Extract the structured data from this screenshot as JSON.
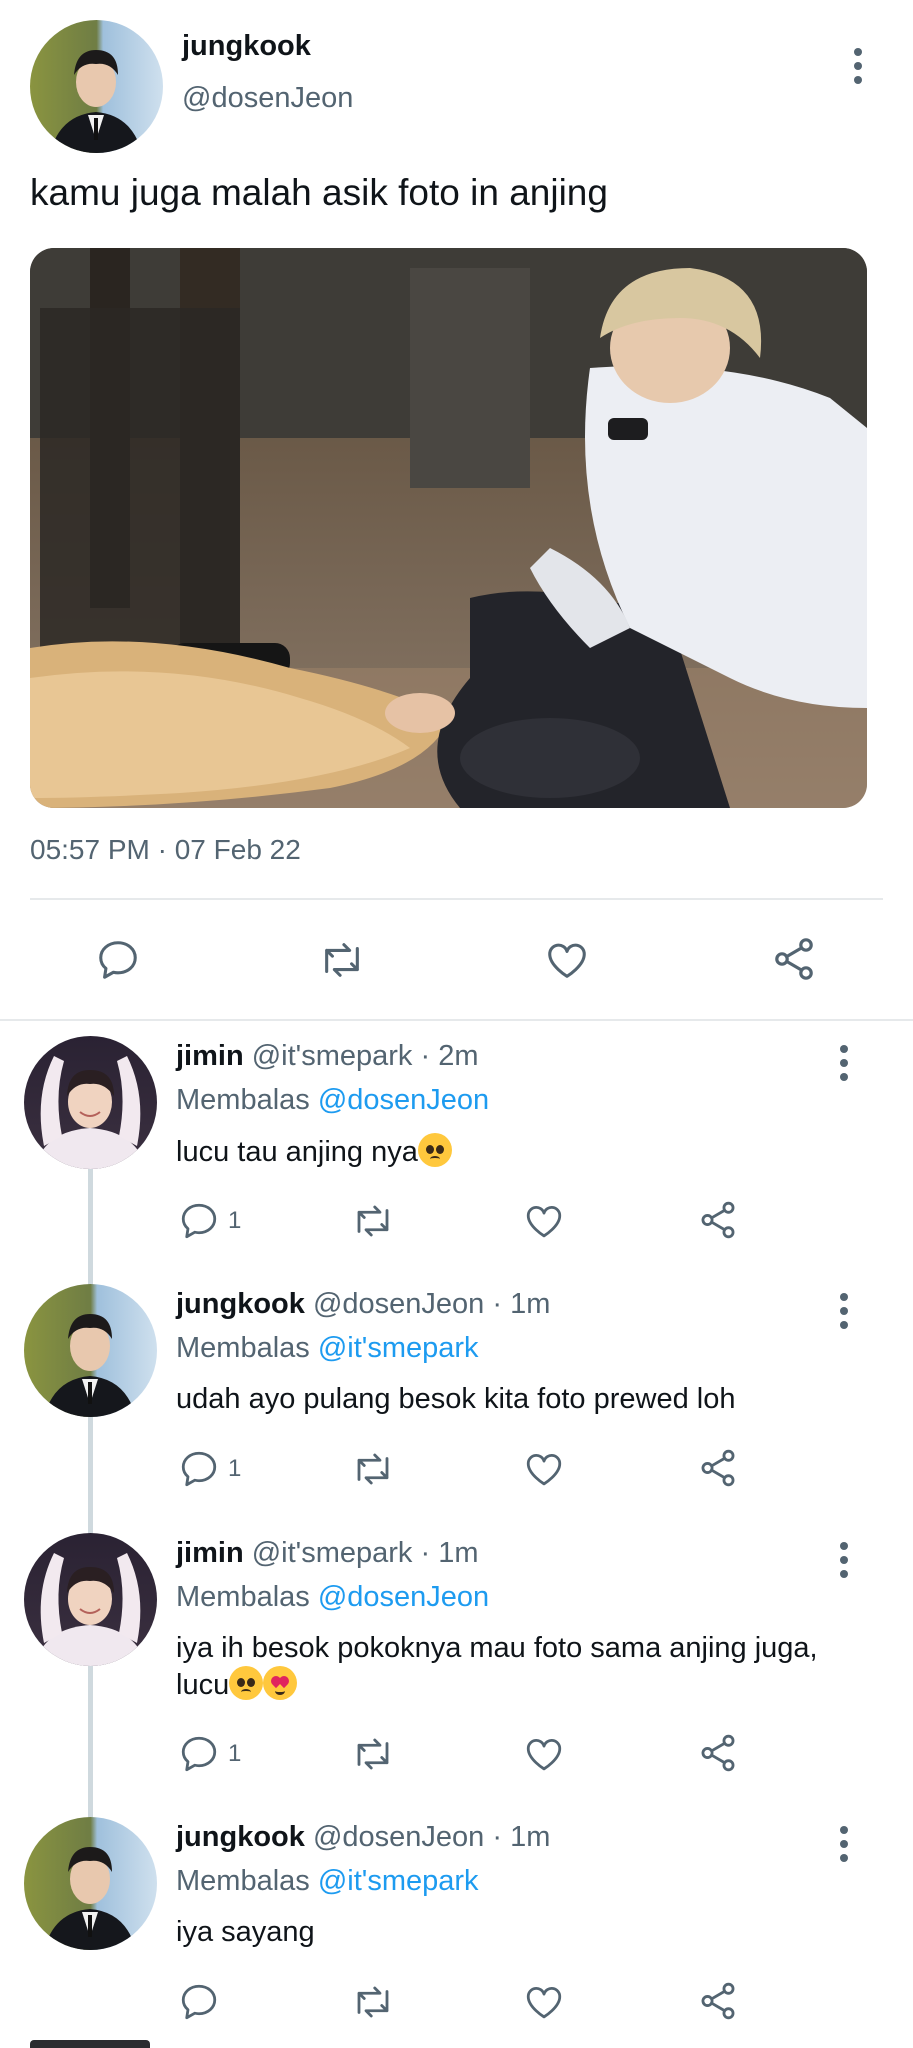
{
  "tweet": {
    "author_name": "jungkook",
    "author_handle": "@dosenJeon",
    "text": "kamu juga malah asik foto in anjing",
    "timestamp": "05:57 PM · 07 Feb 22",
    "media_alt": "person in white shirt sitting on floor holding phone, petting a dog"
  },
  "icons": {
    "reply": "reply-icon",
    "retweet": "retweet-icon",
    "like": "heart-icon",
    "share": "share-icon",
    "more": "more-options-icon"
  },
  "colors": {
    "link": "#1d9bf0",
    "secondary": "#536471",
    "text": "#0f1419",
    "divider": "#e6e9eb"
  },
  "replies": [
    {
      "name": "jimin",
      "handle": "@it'smepark",
      "time": "· 2m",
      "replying_label": "Membalas",
      "replying_to": "@dosenJeon",
      "text": "lucu tau anjing nya",
      "text_line2": "",
      "reply_count": "1"
    },
    {
      "name": "jungkook",
      "handle": "@dosenJeon",
      "time": "· 1m",
      "replying_label": "Membalas",
      "replying_to": "@it'smepark",
      "text": "udah ayo pulang besok kita foto prewed loh",
      "text_line2": "",
      "reply_count": "1"
    },
    {
      "name": "jimin",
      "handle": "@it'smepark",
      "time": "· 1m",
      "replying_label": "Membalas",
      "replying_to": "@dosenJeon",
      "text": "iya ih besok pokoknya mau foto sama anjing juga,",
      "text_line2": "lucu",
      "reply_count": "1"
    },
    {
      "name": "jungkook",
      "handle": "@dosenJeon",
      "time": "· 1m",
      "replying_label": "Membalas",
      "replying_to": "@it'smepark",
      "text": "iya sayang",
      "text_line2": "",
      "reply_count": ""
    }
  ]
}
